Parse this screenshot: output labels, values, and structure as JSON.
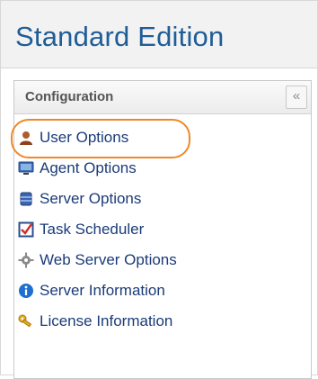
{
  "header": {
    "title": "Standard Edition"
  },
  "panel": {
    "title": "Configuration",
    "collapse_icon": "«"
  },
  "nav": {
    "items": [
      {
        "label": "User Options",
        "icon": "user-icon",
        "highlighted": true
      },
      {
        "label": "Agent Options",
        "icon": "monitor-icon"
      },
      {
        "label": "Server Options",
        "icon": "database-icon"
      },
      {
        "label": "Task Scheduler",
        "icon": "calendar-check-icon"
      },
      {
        "label": "Web Server Options",
        "icon": "gear-icon"
      },
      {
        "label": "Server Information",
        "icon": "info-icon"
      },
      {
        "label": "License Information",
        "icon": "key-icon"
      }
    ]
  },
  "colors": {
    "title": "#1f5d97",
    "link": "#1b3b78",
    "highlight": "#f0882a",
    "info": "#1e6fd0"
  }
}
